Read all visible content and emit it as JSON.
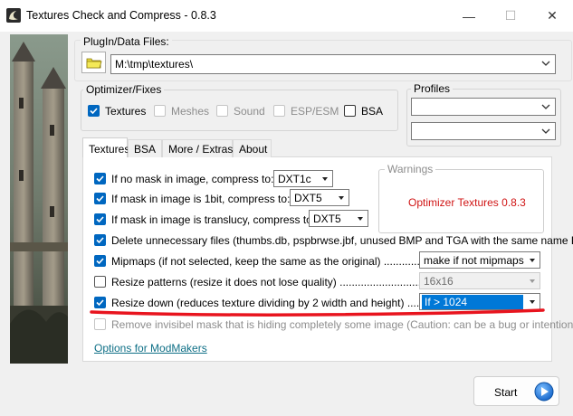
{
  "window": {
    "title": "Textures Check and Compress - 0.8.3",
    "minimize_glyph": "—",
    "maximize_glyph": "☐",
    "close_glyph": "✕"
  },
  "plugin": {
    "label": "PlugIn/Data Files:",
    "path": "M:\\tmp\\textures\\"
  },
  "optimizer": {
    "title": "Optimizer/Fixes",
    "options": [
      {
        "label": "Textures",
        "checked": true,
        "enabled": true
      },
      {
        "label": "Meshes",
        "checked": false,
        "enabled": false
      },
      {
        "label": "Sound",
        "checked": false,
        "enabled": false
      },
      {
        "label": "ESP/ESM",
        "checked": false,
        "enabled": false
      },
      {
        "label": "BSA",
        "checked": false,
        "enabled": true
      }
    ]
  },
  "profiles": {
    "title": "Profiles",
    "value1": "",
    "value2": ""
  },
  "tabs": [
    {
      "label": "Textures",
      "active": true
    },
    {
      "label": "BSA",
      "active": false
    },
    {
      "label": "More / Extras",
      "active": false
    },
    {
      "label": "About",
      "active": false
    }
  ],
  "textures_tab": {
    "rows": [
      {
        "label": "If no mask in image, compress to:",
        "checked": true,
        "combo": "DXT1c"
      },
      {
        "label": "If mask in image is 1bit, compress to:",
        "checked": true,
        "combo": "DXT5"
      },
      {
        "label": "If mask in image is translucy, compress to:",
        "checked": true,
        "combo": "DXT5"
      },
      {
        "label": "Delete unnecessary files (thumbs.db, pspbrwse.jbf, unused BMP and TGA with the same name DDS).",
        "checked": true
      },
      {
        "label": "Mipmaps (if not selected, keep the same as the original) .........................",
        "checked": true,
        "combo": "make if not mipmaps"
      },
      {
        "label": "Resize patterns (resize it does not lose quality) .......................................",
        "checked": false,
        "combo": "16x16",
        "combo_disabled": true
      },
      {
        "label": "Resize down (reduces texture dividing by 2 width and height) .................",
        "checked": true,
        "combo": "If > 1024"
      },
      {
        "label": "Remove invisibel mask that is hiding completely some image (Caution: can be a bug or intentional)",
        "checked": false,
        "enabled": false
      }
    ],
    "warnings_title": "Warnings",
    "warnings_text": "Optimizer Textures 0.8.3",
    "modmakers_link": "Options for ModMakers"
  },
  "start_button": {
    "label": "Start"
  },
  "colors": {
    "accent": "#0067c0",
    "warning": "#d01515",
    "highlight": "#0078d7",
    "annotation": "#e8141e"
  }
}
